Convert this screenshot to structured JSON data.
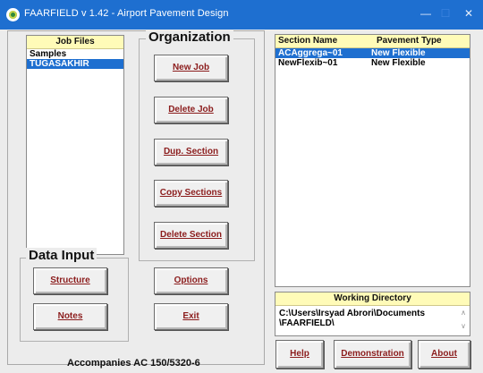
{
  "window": {
    "title": "FAARFIELD v 1.42 - Airport Pavement Design",
    "controls": {
      "minimize": "—",
      "maximize": "☐",
      "close": "✕"
    }
  },
  "job_files": {
    "header": "Job Files",
    "items": [
      "Samples",
      "TUGASAKHIR"
    ],
    "selected_index": 1
  },
  "organization": {
    "title": "Organization",
    "buttons": [
      "New Job",
      "Delete Job",
      "Dup. Section",
      "Copy Sections",
      "Delete Section"
    ]
  },
  "sections": {
    "header_name": "Section Name",
    "header_type": "Pavement Type",
    "rows": [
      {
        "name": "ACAggrega~01",
        "type": "New Flexible"
      },
      {
        "name": "NewFlexib~01",
        "type": "New Flexible"
      }
    ],
    "selected_index": 0
  },
  "data_input": {
    "title": "Data Input",
    "buttons": [
      "Structure",
      "Notes"
    ]
  },
  "misc_buttons": {
    "options": "Options",
    "exit": "Exit"
  },
  "working_directory": {
    "header": "Working Directory",
    "line1": "C:\\Users\\Irsyad Abrori\\Documents",
    "line2": "\\FAARFIELD\\"
  },
  "bottom_buttons": {
    "help": "Help",
    "demonstration": "Demonstration",
    "about": "About"
  },
  "footer": "Accompanies AC 150/5320-6",
  "colors": {
    "title_bar": "#1e6fd0",
    "selection": "#1e6fd0",
    "list_header": "#fffbb8",
    "button_text": "#8b1c1c"
  }
}
